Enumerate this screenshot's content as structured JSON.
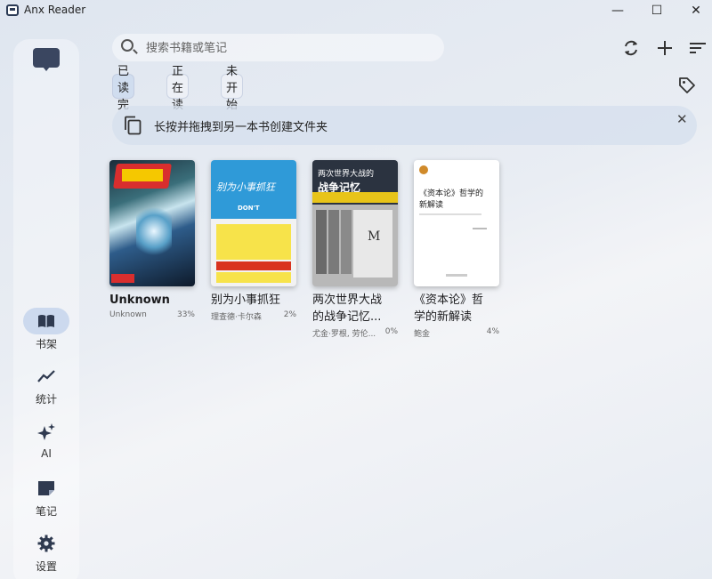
{
  "window": {
    "title": "Anx Reader",
    "controls": {
      "minimize": "—",
      "maximize": "☐",
      "close": "✕"
    }
  },
  "sidebar": {
    "top_icon": "chat-monitor-icon",
    "items": [
      {
        "label": "书架",
        "icon": "book-icon",
        "active": true
      },
      {
        "label": "统计",
        "icon": "chart-line-icon",
        "active": false
      },
      {
        "label": "AI",
        "icon": "sparkle-icon",
        "active": false
      },
      {
        "label": "笔记",
        "icon": "note-icon",
        "active": false
      },
      {
        "label": "设置",
        "icon": "gear-icon",
        "active": false
      }
    ]
  },
  "search": {
    "placeholder": "搜索书籍或笔记"
  },
  "toolbar": {
    "sync_icon": "sync-icon",
    "add_icon": "plus-icon",
    "sort_icon": "sort-icon"
  },
  "filters": [
    {
      "label": "已读完",
      "selected": true
    },
    {
      "label": "正在读",
      "selected": false
    },
    {
      "label": "未开始",
      "selected": false
    }
  ],
  "banner": {
    "text": "长按并拖拽到另一本书创建文件夹",
    "close": "✕"
  },
  "books": [
    {
      "title": "Unknown",
      "author": "Unknown",
      "progress": "33%"
    },
    {
      "title": "别为小事抓狂",
      "author": "理查德·卡尔森",
      "progress": "2%",
      "cover_text": "别为小事抓狂",
      "cover_sub": "DON'T"
    },
    {
      "title": "两次世界大战的战争记忆...",
      "title_line1": "两次世界大战",
      "title_line2": "的战争记忆...",
      "author": "尤金·罗根, 劳伦...",
      "progress": "0%",
      "cover_text": "两次世界大战的",
      "cover_text2": "战争记忆"
    },
    {
      "title": "《资本论》哲学的新解读",
      "title_line1": "《资本论》哲",
      "title_line2": "学的新解读",
      "author": "鲍金",
      "progress": "4%",
      "cover_text": "《资本论》哲学的",
      "cover_text2": "新解读"
    }
  ],
  "colors": {
    "accent": "#c8d6ec",
    "banner_bg": "#d6e0ee",
    "sidebar_icon": "#2f3a50"
  }
}
